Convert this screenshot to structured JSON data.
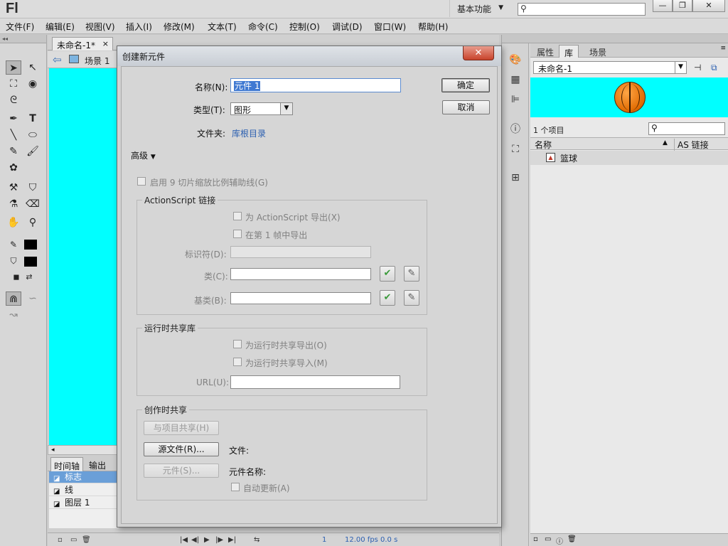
{
  "app": {
    "logo": "Fl",
    "workspace": "基本功能",
    "win_min": "—",
    "win_max": "❐",
    "win_close": "✕"
  },
  "menu": [
    "文件(F)",
    "编辑(E)",
    "视图(V)",
    "插入(I)",
    "修改(M)",
    "文本(T)",
    "命令(C)",
    "控制(O)",
    "调试(D)",
    "窗口(W)",
    "帮助(H)"
  ],
  "document": {
    "tab": "未命名-1*",
    "tab_close": "×",
    "scene": "场景 1"
  },
  "timeline": {
    "tabs": [
      "时间轴",
      "输出"
    ],
    "layers": [
      "标志",
      "线",
      "图层 1"
    ],
    "frame": "1",
    "fps": "12.00 fps",
    "time": "0.0 s"
  },
  "library": {
    "tabs": [
      "属性",
      "库",
      "场景"
    ],
    "document": "未命名-1",
    "count": "1 个项目",
    "col_name": "名称",
    "col_link": "AS 链接",
    "items": [
      {
        "name": "篮球",
        "icon": "graphic-symbol-icon"
      }
    ]
  },
  "dialog": {
    "title": "创建新元件",
    "close": "✕",
    "name_label": "名称(N):",
    "name_value": "元件 1",
    "type_label": "类型(T):",
    "type_value": "图形",
    "folder_label": "文件夹:",
    "folder_value": "库根目录",
    "ok": "确定",
    "cancel": "取消",
    "advanced": "高级",
    "slice9": "启用 9 切片缩放比例辅助线(G)",
    "as_group": "ActionScript 链接",
    "export_as": "为 ActionScript 导出(X)",
    "export_frame1": "在第 1 帧中导出",
    "identifier_label": "标识符(D):",
    "class_label": "类(C):",
    "base_label": "基类(B):",
    "runtime_group": "运行时共享库",
    "runtime_export": "为运行时共享导出(O)",
    "runtime_import": "为运行时共享导入(M)",
    "url_label": "URL(U):",
    "author_group": "创作时共享",
    "share_btn": "与项目共享(H)",
    "source_btn": "源文件(R)...",
    "file_label": "文件:",
    "symbol_btn": "元件(S)...",
    "symbol_name_label": "元件名称:",
    "auto_update": "自动更新(A)"
  },
  "colors": {
    "stage": "#00ffff",
    "selection": "#3f79d2"
  }
}
